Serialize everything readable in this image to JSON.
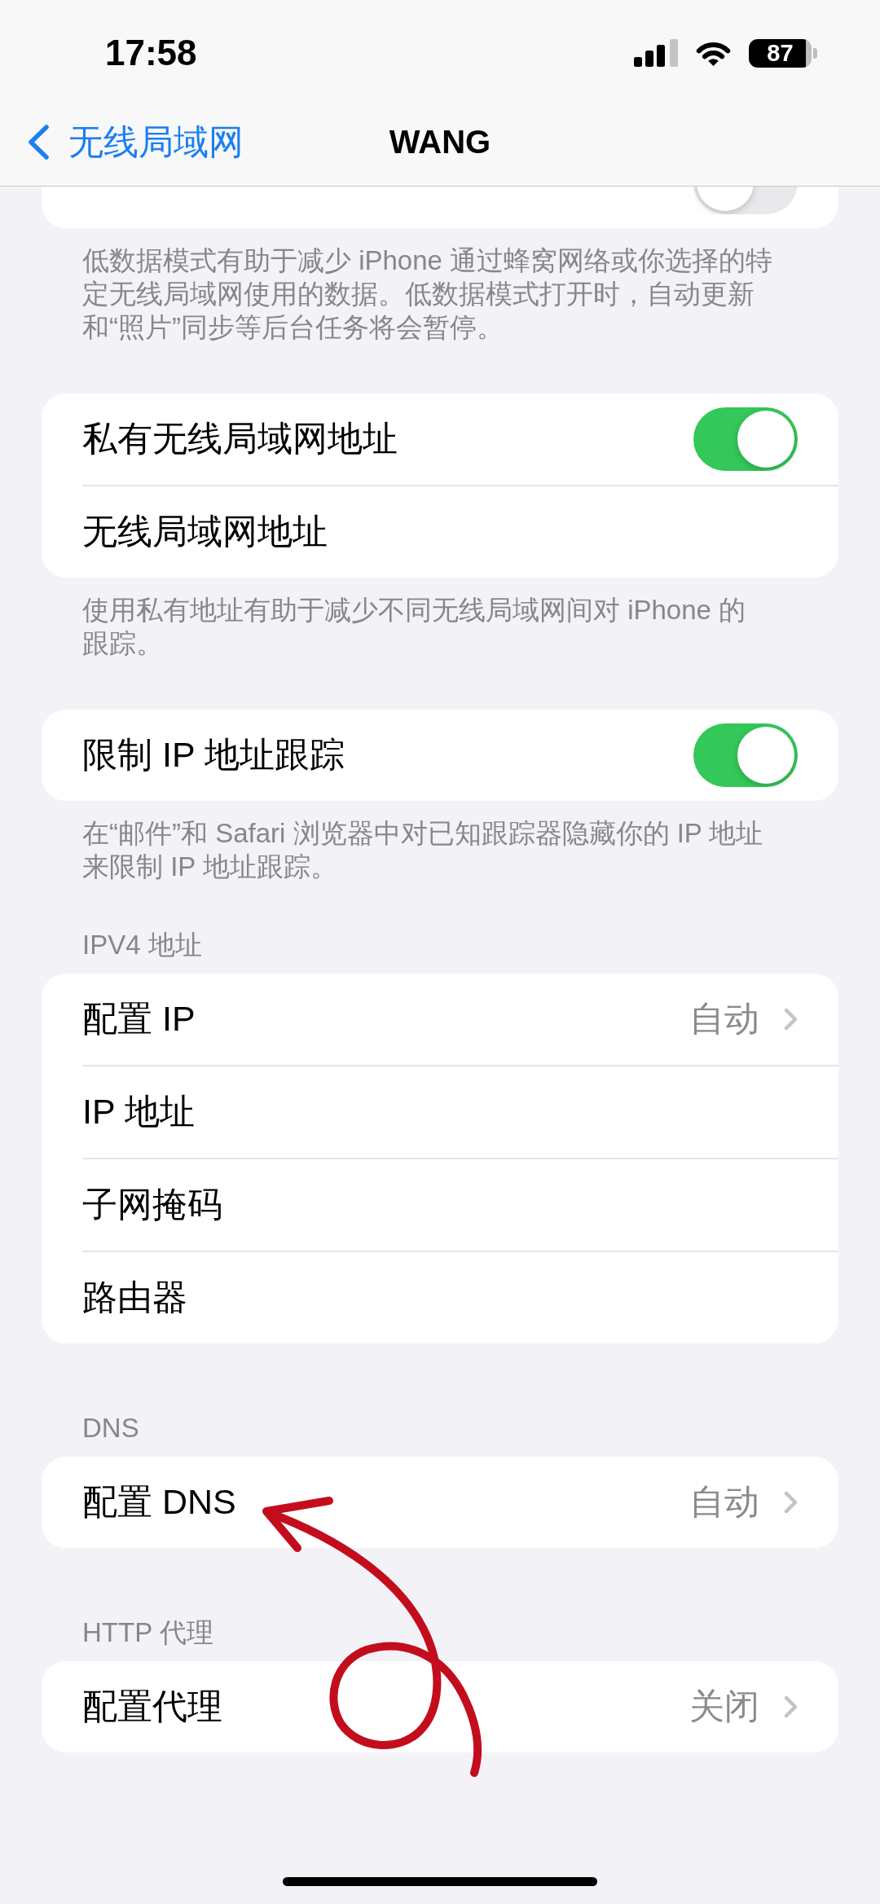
{
  "status_bar": {
    "time": "17:58",
    "battery": "87"
  },
  "nav_bar": {
    "back_label": "无线局域网",
    "title": "WANG"
  },
  "sections": [
    {
      "cut_off": true,
      "rows": [
        {
          "kind": "toggle",
          "on": false
        }
      ],
      "footer": "低数据模式有助于减少 iPhone 通过蜂窝网络或你选择的特定无线局域网使用的数据。低数据模式打开时，自动更新和“照片”同步等后台任务将会暂停。"
    },
    {
      "rows": [
        {
          "kind": "toggle",
          "label": "私有无线局域网地址",
          "on": true
        },
        {
          "kind": "plain",
          "label": "无线局域网地址"
        }
      ],
      "footer": "使用私有地址有助于减少不同无线局域网间对 iPhone 的跟踪。"
    },
    {
      "rows": [
        {
          "kind": "toggle",
          "label": "限制 IP 地址跟踪",
          "on": true
        }
      ],
      "footer": "在“邮件”和 Safari 浏览器中对已知跟踪器隐藏你的 IP 地址来限制 IP 地址跟踪。"
    },
    {
      "header": "IPV4 地址",
      "rows": [
        {
          "kind": "link",
          "label": "配置 IP",
          "value": "自动"
        },
        {
          "kind": "plain",
          "label": "IP 地址"
        },
        {
          "kind": "plain",
          "label": "子网掩码"
        },
        {
          "kind": "plain",
          "label": "路由器"
        }
      ]
    },
    {
      "header": "DNS",
      "rows": [
        {
          "kind": "link",
          "label": "配置 DNS",
          "value": "自动"
        }
      ]
    },
    {
      "header": "HTTP 代理",
      "rows": [
        {
          "kind": "link",
          "label": "配置代理",
          "value": "关闭"
        }
      ]
    }
  ]
}
